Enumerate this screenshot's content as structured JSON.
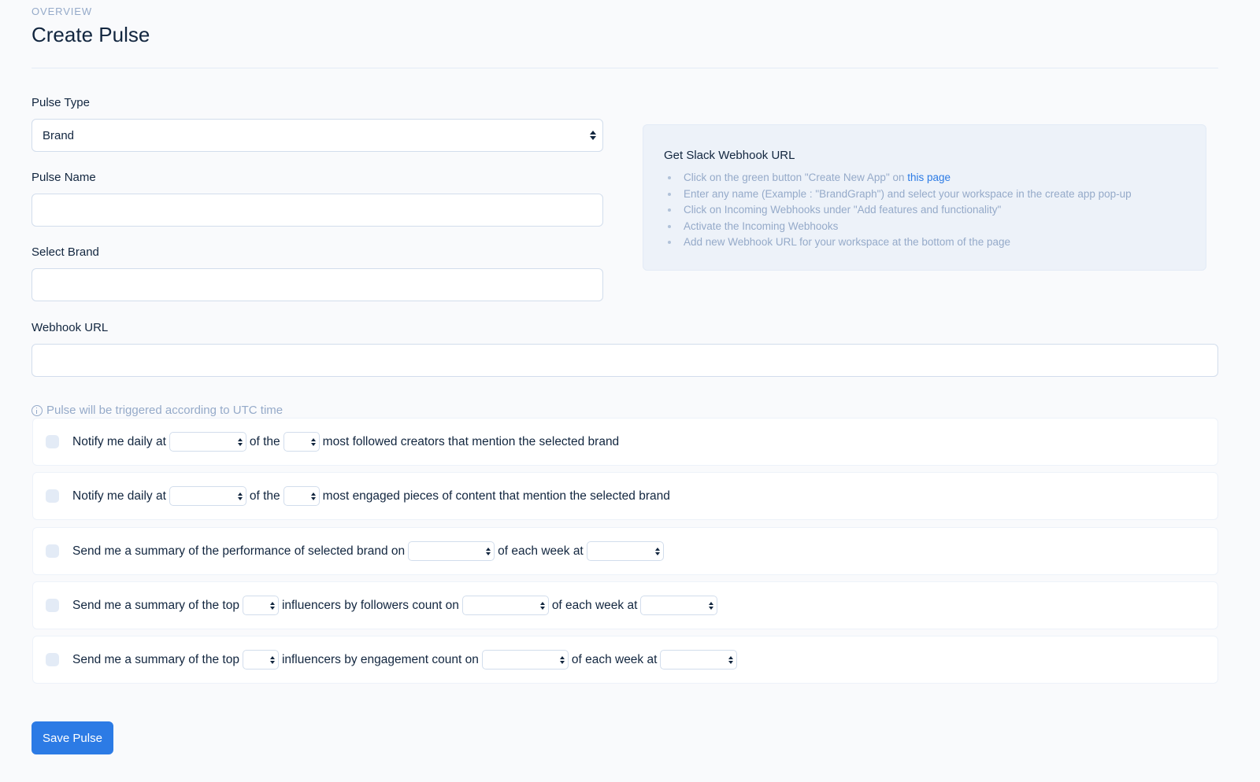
{
  "header": {
    "pretitle": "OVERVIEW",
    "title": "Create Pulse"
  },
  "form": {
    "pulse_type": {
      "label": "Pulse Type",
      "value": "Brand"
    },
    "pulse_name": {
      "label": "Pulse Name",
      "value": "",
      "placeholder": ""
    },
    "select_brand": {
      "label": "Select Brand",
      "value": "",
      "placeholder": ""
    },
    "webhook_url": {
      "label": "Webhook URL",
      "value": "",
      "placeholder": ""
    }
  },
  "help": {
    "title": "Get Slack Webhook URL",
    "steps": [
      "Click on the green button \"Create New App\" on ",
      "Enter any name (Example : \"BrandGraph\") and select your workspace in the create app pop-up",
      "Click on Incoming Webhooks under \"Add features and functionality\"",
      "Activate the Incoming Webhooks",
      "Add new Webhook URL for your workspace at the bottom of the page"
    ],
    "link_text": "this page"
  },
  "note": {
    "icon": "info-icon",
    "text": "Pulse will be triggered according to UTC time"
  },
  "rules": [
    {
      "parts": [
        "Notify me daily at",
        "of the",
        "most followed creators that mention the selected brand"
      ],
      "checked": false
    },
    {
      "parts": [
        "Notify me daily at",
        "of the",
        "most engaged pieces of content that mention the selected brand"
      ],
      "checked": false
    },
    {
      "parts": [
        "Send me a summary of the performance of selected brand on",
        "of each week at"
      ],
      "checked": false
    },
    {
      "parts": [
        "Send me a summary of the top",
        "influencers by followers count on",
        "of each week at"
      ],
      "checked": false
    },
    {
      "parts": [
        "Send me a summary of the top",
        "influencers by engagement count on",
        "of each week at"
      ],
      "checked": false
    }
  ],
  "actions": {
    "save_label": "Save Pulse"
  },
  "colors": {
    "accent": "#2c7be5",
    "text": "#12263f",
    "muted": "#95aac9",
    "page_bg": "#f9fafc"
  }
}
